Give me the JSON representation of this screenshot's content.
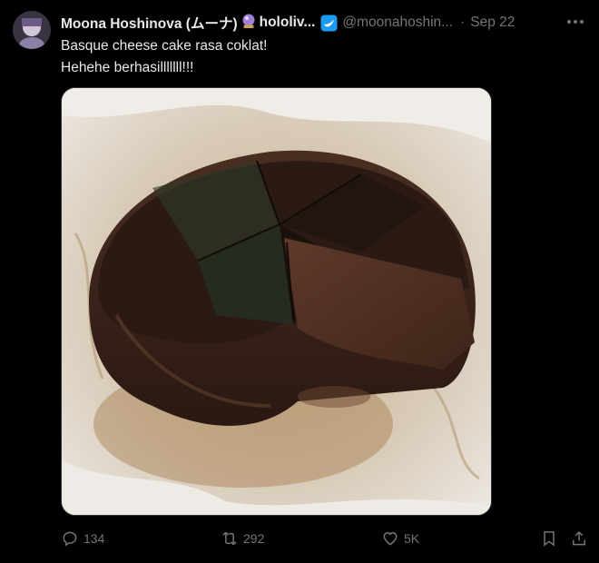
{
  "tweet": {
    "author_name": "Moona Hoshinova (ムーナ)",
    "affiliation": "hololiv...",
    "handle": "@moonahoshin...",
    "separator": "·",
    "time": "Sep 22",
    "text_lines": [
      "Basque cheese cake rasa coklat!",
      "Hehehe berhasilllllll!!!"
    ],
    "media_icon": "chocolate-basque-cheesecake-photo",
    "actions": {
      "reply_count": "134",
      "retweet_count": "292",
      "like_count": "5K"
    }
  },
  "colors": {
    "background": "#000000",
    "text": "#e7e9ea",
    "muted": "#71767b",
    "verified": "#1d9bf0"
  }
}
